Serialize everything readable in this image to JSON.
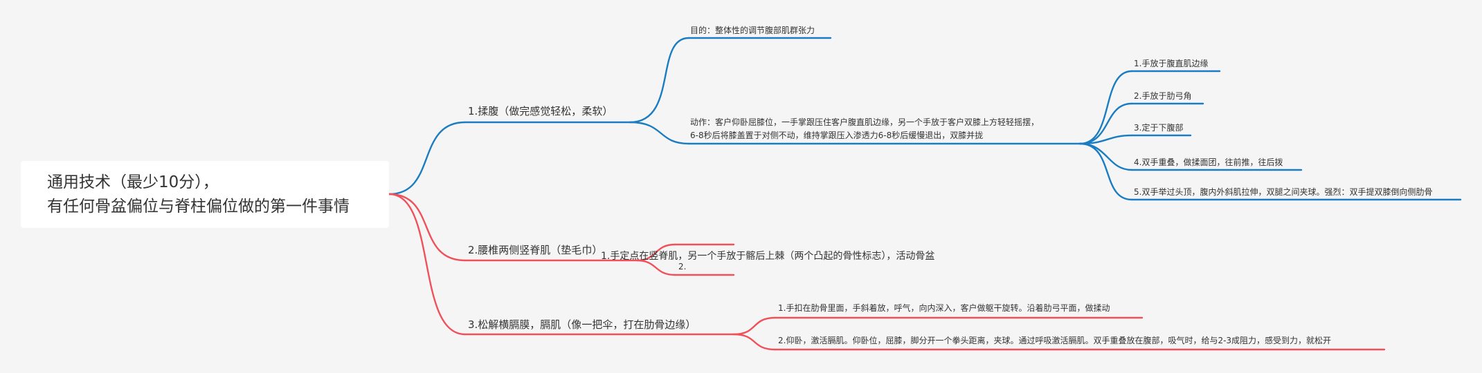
{
  "colors": {
    "background": "#f5f5f5",
    "blue_branch": "#1a7cc1",
    "red_branch": "#f0505a",
    "text": "#333333"
  },
  "root": {
    "line1": "通用技术（最少10分），",
    "line2": "有任何骨盆偏位与脊柱偏位做的第一件事情"
  },
  "branches": {
    "massage": {
      "label": "1.揉腹（做完感觉轻松，柔软）",
      "purpose": "目的：整体性的调节腹部肌群张力",
      "action_line1": "动作：客户仰卧屈膝位，一手掌跟压住客户腹直肌边缘，另一个手放于客户双膝上方轻轻摇摆，",
      "action_line2": "6-8秒后将膝盖置于对侧不动，维持掌跟压入渗透力6-8秒后缓慢退出，双膝并拢",
      "steps": [
        "1.手放于腹直肌边缘",
        "2.手放于肋弓角",
        "3.定于下腹部",
        "4.双手重叠，做揉面团，往前推，往后拨",
        "5.双手举过头顶，腹内外斜肌拉伸，双腿之间夹球。强烈：双手提双膝倒向侧肋骨"
      ]
    },
    "lumbar": {
      "label": "2.腰椎两侧竖脊肌（垫毛巾）",
      "item1": "1.手定点在竖脊肌，另一个手放于髂后上棘（两个凸起的骨性标志），活动骨盆",
      "item2": "2."
    },
    "diaphragm": {
      "label": "3.松解横膈膜，膈肌（像一把伞，打在肋骨边缘）",
      "item1": "1.手扣在肋骨里面，手斜着放，呼气，向内深入，客户做躯干旋转。沿着肋弓平面，做揉动",
      "item2": "2.仰卧，激活膈肌。仰卧位，屈膝，脚分开一个拳头距离，夹球。通过呼吸激活膈肌。双手重叠放在腹部，吸气时，给与2-3成阻力，感受到力，就松开"
    }
  }
}
